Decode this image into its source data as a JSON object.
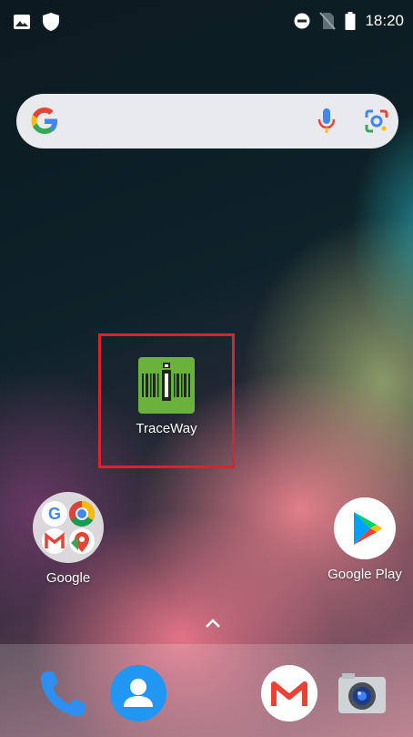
{
  "status_bar": {
    "time": "18:20",
    "left_icons": [
      "image-icon",
      "shield-icon"
    ],
    "right_icons": [
      "do-not-disturb-icon",
      "no-sim-icon",
      "battery-icon"
    ]
  },
  "search_bar": {
    "icons": [
      "google-g-icon",
      "mic-icon",
      "lens-icon"
    ]
  },
  "apps": {
    "traceway": {
      "label": "TraceWay",
      "icon": "traceway-barcode-icon"
    },
    "google_folder": {
      "label": "Google",
      "icon": "google-folder-icon"
    },
    "google_play": {
      "label": "Google Play",
      "icon": "google-play-icon"
    }
  },
  "app_drawer": {
    "icon": "chevron-up-icon"
  },
  "dock": {
    "items": [
      {
        "name": "Phone",
        "icon": "phone-icon"
      },
      {
        "name": "Contacts",
        "icon": "contacts-icon"
      },
      {
        "name": "Gmail",
        "icon": "gmail-icon"
      },
      {
        "name": "Camera",
        "icon": "camera-icon"
      }
    ]
  },
  "colors": {
    "highlight": "#e0202a",
    "traceway_green": "#6ab23c"
  }
}
